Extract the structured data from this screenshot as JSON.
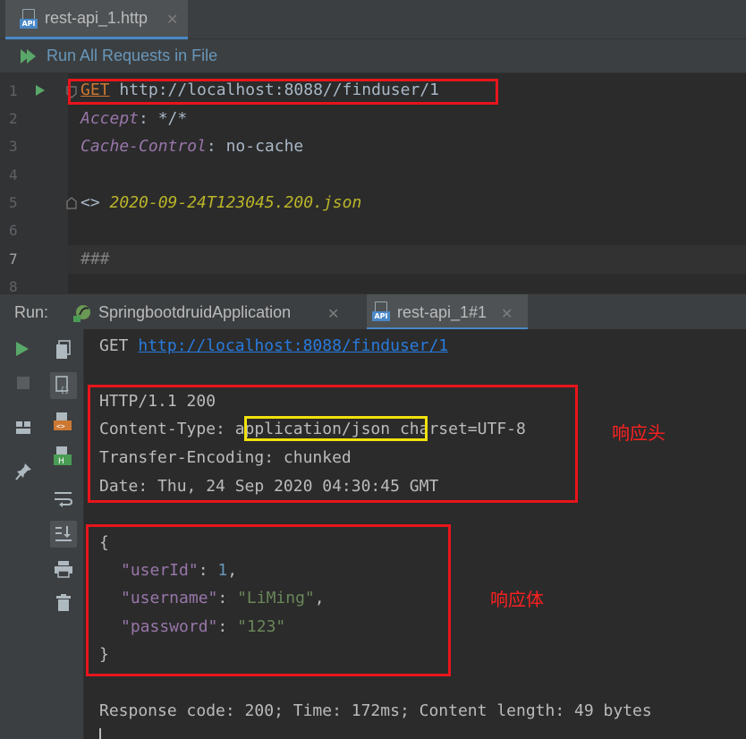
{
  "editor_tab": {
    "label": "rest-api_1.http",
    "icon": "api-file-icon"
  },
  "toolbar": {
    "run_all_label": "Run All Requests in File"
  },
  "editor": {
    "line_numbers": [
      "1",
      "2",
      "3",
      "4",
      "5",
      "6",
      "7",
      "8"
    ],
    "request": {
      "method": "GET",
      "url": " http://localhost:8088//finduser/1"
    },
    "headers": [
      {
        "name": "Accept",
        "sep": ": ",
        "value": "*/*"
      },
      {
        "name": "Cache-Control",
        "sep": ": ",
        "value": "no-cache"
      }
    ],
    "response_ref": {
      "prefix": "<> ",
      "file": "2020-09-24T123045.200.json"
    },
    "separator": "###"
  },
  "run_panel": {
    "label": "Run:",
    "tabs": [
      {
        "label": "SpringbootdruidApplication",
        "icon": "spring-boot-icon"
      },
      {
        "label": "rest-api_1#1",
        "icon": "api-file-icon"
      }
    ]
  },
  "output": {
    "request_method": "GET ",
    "request_url": "http://localhost:8088/finduser/1",
    "status_line": "HTTP/1.1 200",
    "content_type_key": "Content-Type: ",
    "content_type_value": "application/json",
    "content_type_rest": " charset=UTF-8",
    "transfer_encoding": "Transfer-Encoding: chunked",
    "date": "Date: Thu, 24 Sep 2020 04:30:45 GMT",
    "body_open": "{",
    "body_fields": [
      {
        "key": "\"userId\"",
        "colon": ": ",
        "value": "1",
        "trail": ","
      },
      {
        "key": "\"username\"",
        "colon": ": ",
        "value": "\"LiMing\"",
        "trail": ","
      },
      {
        "key": "\"password\"",
        "colon": ": ",
        "value": "\"123\"",
        "trail": ""
      }
    ],
    "body_close": "}",
    "summary": "Response code: 200; Time: 172ms; Content length: 49 bytes"
  },
  "annotations": {
    "headers_label": "响应头",
    "body_label": "响应体"
  },
  "colors": {
    "background": "#2b2b2b",
    "keyword": "#cc7832",
    "header_name": "#9876aa",
    "string": "#6a8759",
    "number": "#6897bb",
    "file_ref": "#bbb529",
    "run_green": "#59a869",
    "annotation_red": "#ff2020",
    "highlight_yellow": "#ffff00"
  }
}
